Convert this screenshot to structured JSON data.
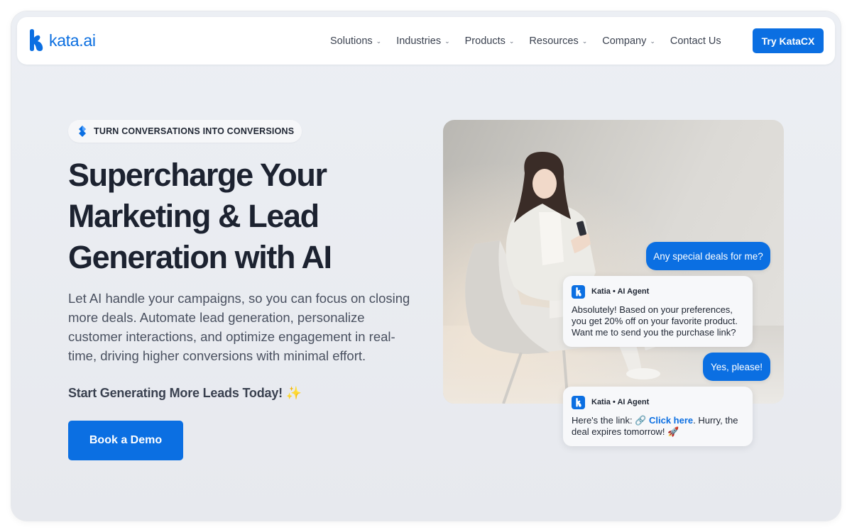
{
  "brand": {
    "logo_text": "kata.ai",
    "color": "#0b6fe2"
  },
  "nav": {
    "items": [
      {
        "label": "Solutions",
        "has_dropdown": true
      },
      {
        "label": "Industries",
        "has_dropdown": true
      },
      {
        "label": "Products",
        "has_dropdown": true
      },
      {
        "label": "Resources",
        "has_dropdown": true
      },
      {
        "label": "Company",
        "has_dropdown": true
      },
      {
        "label": "Contact Us",
        "has_dropdown": false
      }
    ],
    "cta_label": "Try KataCX"
  },
  "hero": {
    "badge": "TURN CONVERSATIONS INTO CONVERSIONS",
    "headline": "Supercharge Your Marketing & Lead Generation with AI",
    "subtext": "Let AI handle your campaigns, so you can focus on closing more deals. Automate lead generation, personalize customer interactions, and optimize engagement in real-time, driving higher conversions with minimal effort.",
    "cta_text": "Start Generating More Leads Today!",
    "cta_emoji": "✨",
    "demo_button": "Book a Demo"
  },
  "chat": {
    "user_msg_1": "Any special deals for me?",
    "agent_name_1": "Katia • AI Agent",
    "agent_msg_1": "Absolutely! Based on your preferences, you get 20% off on your favorite product. Want me to send you the purchase link?",
    "user_msg_2": "Yes, please!",
    "agent_name_2": "Katia • AI Agent",
    "agent_msg_2_prefix": "Here's the link: 🔗 ",
    "agent_msg_2_link": "Click here",
    "agent_msg_2_suffix": ". Hurry, the deal expires tomorrow! 🚀"
  }
}
